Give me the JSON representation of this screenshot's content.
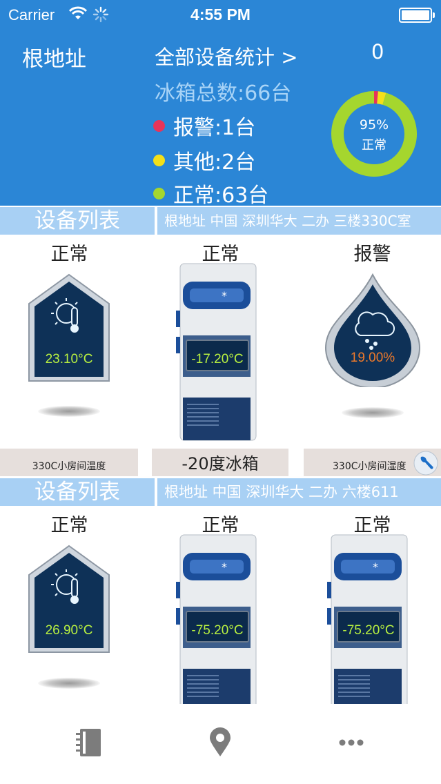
{
  "status_bar": {
    "carrier": "Carrier",
    "time": "4:55 PM"
  },
  "header": {
    "root_label": "根地址",
    "stats_link": "全部设备统计 >",
    "count": "0",
    "total": "冰箱总数:66台",
    "legend": [
      {
        "label": "报警:1台",
        "color": "#e8345a"
      },
      {
        "label": "其他:2台",
        "color": "#f4e019"
      },
      {
        "label": "正常:63台",
        "color": "#a5d62e"
      }
    ],
    "donut": {
      "percent": "95%",
      "label": "正常",
      "normal": 63,
      "other": 2,
      "alarm": 1
    }
  },
  "sections": [
    {
      "title": "设备列表",
      "path": "根地址 中国 深圳华大 二办 三楼330C室",
      "devices": [
        {
          "status": "正常",
          "kind": "house",
          "reading": "23.10°C",
          "name": "330C小房间温度"
        },
        {
          "status": "正常",
          "kind": "freezer",
          "reading": "-17.20°C",
          "name": "-20度冰箱"
        },
        {
          "status": "报警",
          "kind": "drop",
          "reading": "19.00%",
          "name": "330C小房间湿度"
        }
      ]
    },
    {
      "title": "设备列表",
      "path": "根地址 中国 深圳华大 二办 六楼611",
      "devices": [
        {
          "status": "正常",
          "kind": "house",
          "reading": "26.90°C"
        },
        {
          "status": "正常",
          "kind": "freezer",
          "reading": "-75.20°C"
        },
        {
          "status": "正常",
          "kind": "freezer",
          "reading": "-75.20°C"
        }
      ]
    }
  ],
  "colors": {
    "header_bg": "#2b86d6",
    "section_bar": "#a8d0f4",
    "reading_green": "#b8f040",
    "reading_orange": "#f07a2a"
  },
  "tabbar": [
    {
      "icon": "notebook-icon"
    },
    {
      "icon": "location-pin-icon"
    },
    {
      "icon": "more-icon"
    }
  ]
}
